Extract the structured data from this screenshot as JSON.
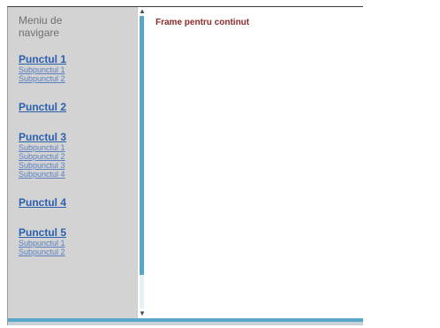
{
  "nav": {
    "title": "Meniu de navigare",
    "groups": [
      {
        "label": "Punctul 1",
        "subs": [
          "Subpunctul 1",
          "Subpunctul 2"
        ]
      },
      {
        "label": "Punctul 2",
        "subs": []
      },
      {
        "label": "Punctul 3",
        "subs": [
          "Subpunctul 1",
          "Subpunctul 2",
          "Subpunctul 3",
          "Subpunctul 4"
        ]
      },
      {
        "label": "Punctul 4",
        "subs": []
      },
      {
        "label": "Punctul 5",
        "subs": [
          "Subpunctul 1",
          "Subpunctul 2"
        ]
      }
    ]
  },
  "content": {
    "text": "Frame pentru continut"
  },
  "colors": {
    "nav_bg": "#d3d3d3",
    "link": "#2a5fb0",
    "scroll_accent": "#5aa6c8"
  }
}
